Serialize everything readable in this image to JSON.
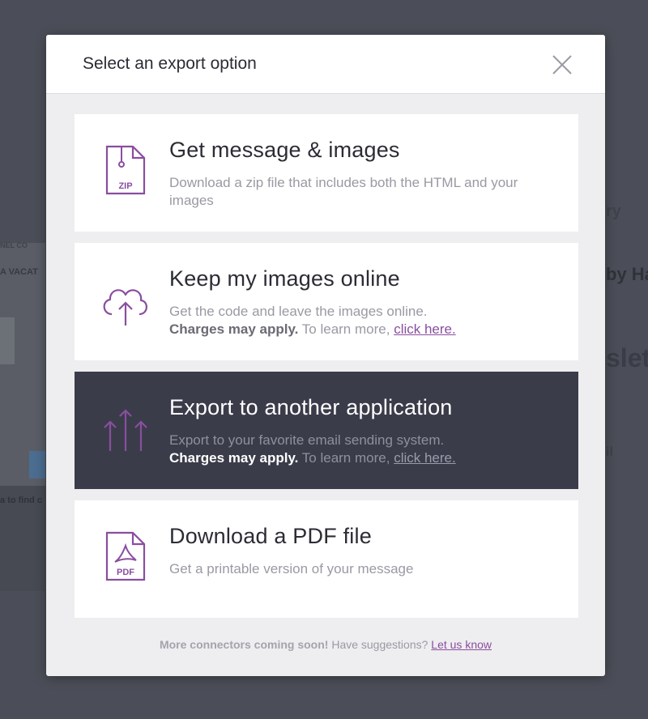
{
  "background": {
    "fragments": [
      "NEL CO",
      "A VACAT",
      "a to find c",
      "ry",
      "by Ha",
      "slet",
      "il"
    ]
  },
  "modal": {
    "title": "Select an export option",
    "close_icon": "close-icon"
  },
  "options": [
    {
      "icon": "zip-file-icon",
      "icon_label": "ZIP",
      "title": "Get message & images",
      "description": "Download a zip file that includes both the HTML and your images"
    },
    {
      "icon": "cloud-upload-icon",
      "title": "Keep my images online",
      "description": "Get the code and leave the images online.",
      "charges": "Charges may apply.",
      "learn_more": "To learn more,",
      "link": "click here."
    },
    {
      "icon": "export-arrows-icon",
      "title": "Export to another application",
      "description": "Export to your favorite email sending system.",
      "charges": "Charges may apply.",
      "learn_more": "To learn more,",
      "link": "click here."
    },
    {
      "icon": "pdf-file-icon",
      "icon_label": "PDF",
      "title": "Download a PDF file",
      "description": "Get a printable version of your message"
    }
  ],
  "footer": {
    "strong": "More connectors coming soon!",
    "text": "Have suggestions?",
    "link": "Let us know"
  },
  "colors": {
    "accent_purple": "#8a4e9f",
    "active_bg": "#3a3c4a",
    "overlay": "#4b4e58"
  }
}
